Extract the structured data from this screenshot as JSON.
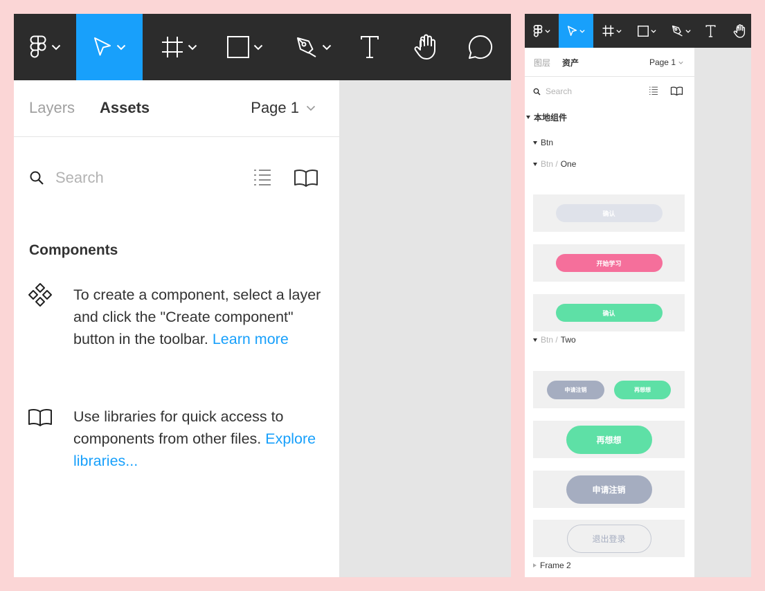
{
  "colors": {
    "toolbar_bg": "#2c2c2c",
    "active_tool": "#18a0fb",
    "link": "#18a0fb",
    "canvas": "#e5e5e5",
    "page_bg": "#fbd6d6",
    "btn_gray": "#dfe2ea",
    "btn_pink": "#f56f9b",
    "btn_green": "#5ee0a6",
    "btn_slate": "#a5adc0"
  },
  "toolbar": {
    "tools": [
      {
        "icon": "figma-logo-icon",
        "has_menu": true
      },
      {
        "icon": "move-tool-icon",
        "has_menu": true,
        "active": true
      },
      {
        "icon": "frame-tool-icon",
        "has_menu": true
      },
      {
        "icon": "rectangle-tool-icon",
        "has_menu": true
      },
      {
        "icon": "pen-tool-icon",
        "has_menu": true
      },
      {
        "icon": "text-tool-icon",
        "has_menu": false
      },
      {
        "icon": "hand-tool-icon",
        "has_menu": false
      },
      {
        "icon": "comment-tool-icon",
        "has_menu": false
      }
    ]
  },
  "left_panel": {
    "tabs": {
      "layers": "Layers",
      "assets": "Assets"
    },
    "page_selector": "Page 1",
    "search_placeholder": "Search",
    "components_title": "Components",
    "tip1_text": "To create a component, select a layer and click the \"Create component\" button in the toolbar. ",
    "tip1_link": "Learn more",
    "tip2_text": "Use libraries for quick access to components from other files. ",
    "tip2_link": "Explore libraries..."
  },
  "right_panel": {
    "tabs": {
      "layers": "图层",
      "assets": "资产"
    },
    "page_selector": "Page 1",
    "search_placeholder": "Search",
    "tree": {
      "local_components": "本地组件",
      "btn": "Btn",
      "btn_one_prefix": "Btn /",
      "btn_one": "One",
      "btn_two_prefix": "Btn /",
      "btn_two": "Two",
      "frame2": "Frame 2"
    },
    "components": {
      "confirm_gray": "确认",
      "start_learning": "开始学习",
      "confirm_green": "确认",
      "apply_cancel_small": "申请注销",
      "think_again_small": "再想想",
      "think_again": "再想想",
      "apply_cancel": "申请注销",
      "logout": "退出登录"
    }
  }
}
